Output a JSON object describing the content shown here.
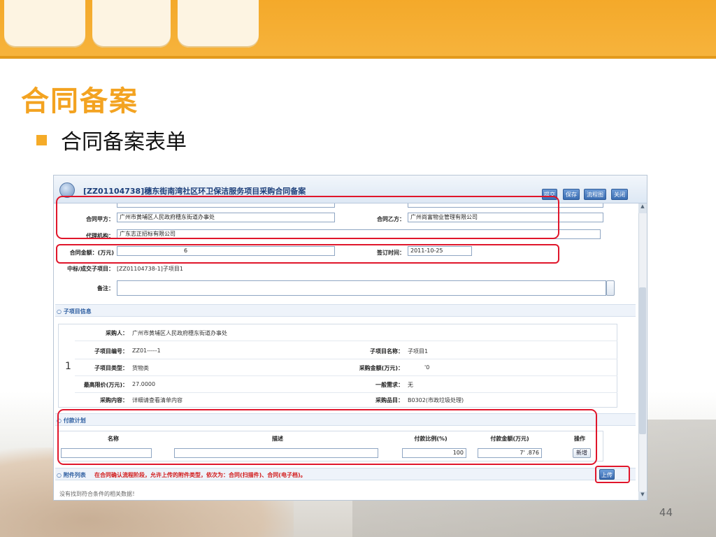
{
  "slide": {
    "title": "合同备案",
    "bullet": "合同备案表单",
    "page_number": "44"
  },
  "form": {
    "title": "[ZZ01104738]穗东街南湾社区环卫保洁服务项目采购合同备案",
    "buttons": [
      "提交",
      "保存",
      "流程图",
      "关闭"
    ],
    "party_a_label": "合同甲方：",
    "party_a_value": "广州市黄埔区人民政府穗东街道办事处",
    "party_b_label": "合同乙方：",
    "party_b_value": "广州尚富物业管理有限公司",
    "agent_label": "代理机构：",
    "agent_value": "广东志正招标有限公司",
    "amount_label": "合同金额：(万元)",
    "amount_value": "6",
    "sign_time_label": "签订时间：",
    "sign_time_value": "2011-10-25",
    "bid_item_label": "中标/成交子项目：",
    "bid_item_value": "[ZZ01104738-1]子项目1",
    "remark_label": "备注："
  },
  "sub_project": {
    "header": "子项目信息",
    "index": "1",
    "purchaser_label": "采购人：",
    "purchaser_value": "广州市黄埔区人民政府穗东街道办事处",
    "code_label": "子项目编号：",
    "code_value": "ZZ01-----1",
    "name_label": "子项目名称：",
    "name_value": "子项目1",
    "type_label": "子项目类型：",
    "type_value": "货物类",
    "amount_label": "采购金额(万元)：",
    "amount_value": "'0",
    "max_price_label": "最高限价(万元)：",
    "max_price_value": "27.0000",
    "general_req_label": "一般需求：",
    "general_req_value": "无",
    "content_label": "采购内容：",
    "content_value": "详细请查看清单内容",
    "item_label": "采购品目：",
    "item_value": "B0302(市政垃圾处理)"
  },
  "payment_plan": {
    "header": "付款计划",
    "columns": [
      "名称",
      "描述",
      "付款比例(%)",
      "付款金额(万元)",
      "操作"
    ],
    "ratio_value": "100",
    "amount_value": "7' .876",
    "add_button": "新增"
  },
  "attachments": {
    "header": "附件列表",
    "note": "在合同确认流程阶段，允许上传的附件类型，依次为：合同(扫描件)、合同(电子档)。",
    "upload_button": "上传",
    "empty_text": "没有找到符合条件的相关数据！"
  }
}
